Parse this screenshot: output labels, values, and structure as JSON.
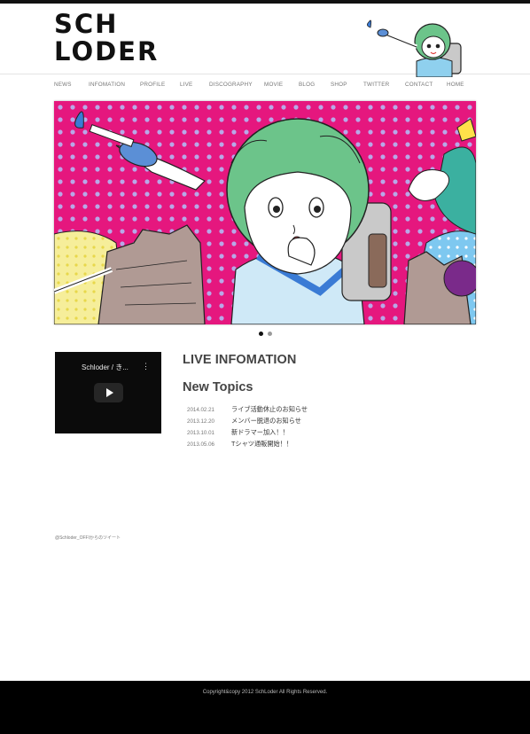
{
  "site": {
    "logo_text": "SCH LODER",
    "logo_line1": "SCH",
    "logo_line2": "LODER"
  },
  "nav": {
    "items": [
      {
        "label": "NEWS"
      },
      {
        "label": "INFOMATION"
      },
      {
        "label": "PROFILE"
      },
      {
        "label": "LIVE"
      },
      {
        "label": "DISCOGRAPHY"
      },
      {
        "label": "MOVIE"
      },
      {
        "label": "BLOG"
      },
      {
        "label": "SHOP"
      },
      {
        "label": "TWITTER"
      },
      {
        "label": "CONTACT"
      },
      {
        "label": "HOME"
      }
    ]
  },
  "slider": {
    "active_index": 0,
    "count": 2
  },
  "video": {
    "title": "Schloder / き...",
    "menu_icon": "⋮"
  },
  "main": {
    "live_heading": "LIVE INFOMATION",
    "topics_heading": "New Topics",
    "topics": [
      {
        "date": "2014.02.21",
        "title": "ライブ活動休止のお知らせ"
      },
      {
        "date": "2013.12.20",
        "title": "メンバー脱退のお知らせ"
      },
      {
        "date": "2013.10.01",
        "title": "新ドラマー加入！！"
      },
      {
        "date": "2013.05.06",
        "title": "Tシャツ通販開始！！"
      }
    ]
  },
  "tweets": {
    "link_text": "@Schloder_OFFIからのツイート"
  },
  "footer": {
    "copyright": "Copyright&copy 2012 SchLoder All Rights Reserved."
  },
  "colors": {
    "hero_background": "#e5177e",
    "hair": "#6cc48a",
    "sky": "#7ec8f0",
    "footer": "#000000"
  }
}
